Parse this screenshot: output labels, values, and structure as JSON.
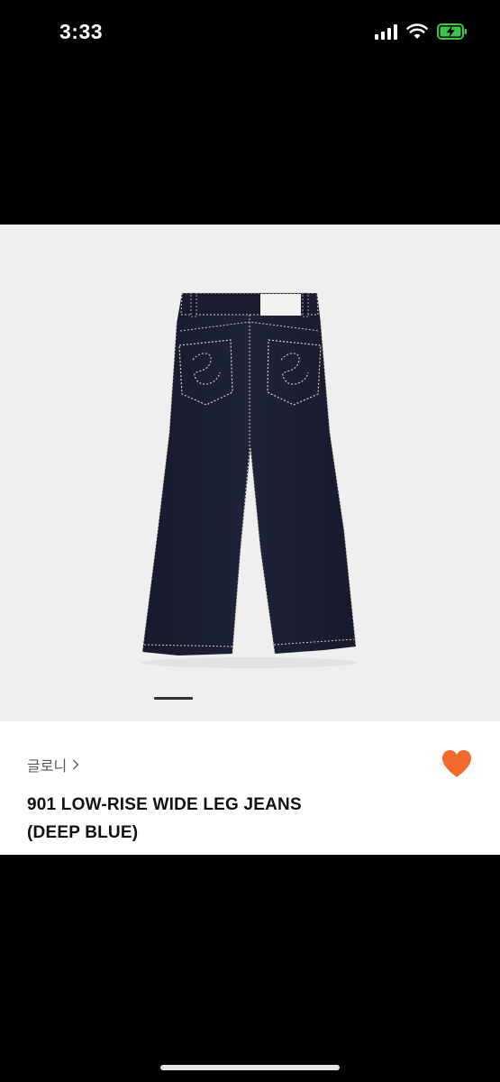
{
  "status_bar": {
    "time": "3:33"
  },
  "product": {
    "brand": "글로니",
    "title_line1": "901 LOW-RISE WIDE LEG JEANS",
    "title_line2": "(DEEP BLUE)",
    "image_carousel": {
      "active_index": 1
    },
    "liked": true
  },
  "colors": {
    "accent": "#f26a2e",
    "denim": "#1c1f33",
    "stitch": "#d9d2c0",
    "image_bg": "#efefef"
  },
  "icons": {
    "brand_chevron": "chevron-right-icon",
    "like": "heart-icon",
    "signal": "signal-icon",
    "wifi": "wifi-icon",
    "battery": "battery-charging-icon"
  }
}
